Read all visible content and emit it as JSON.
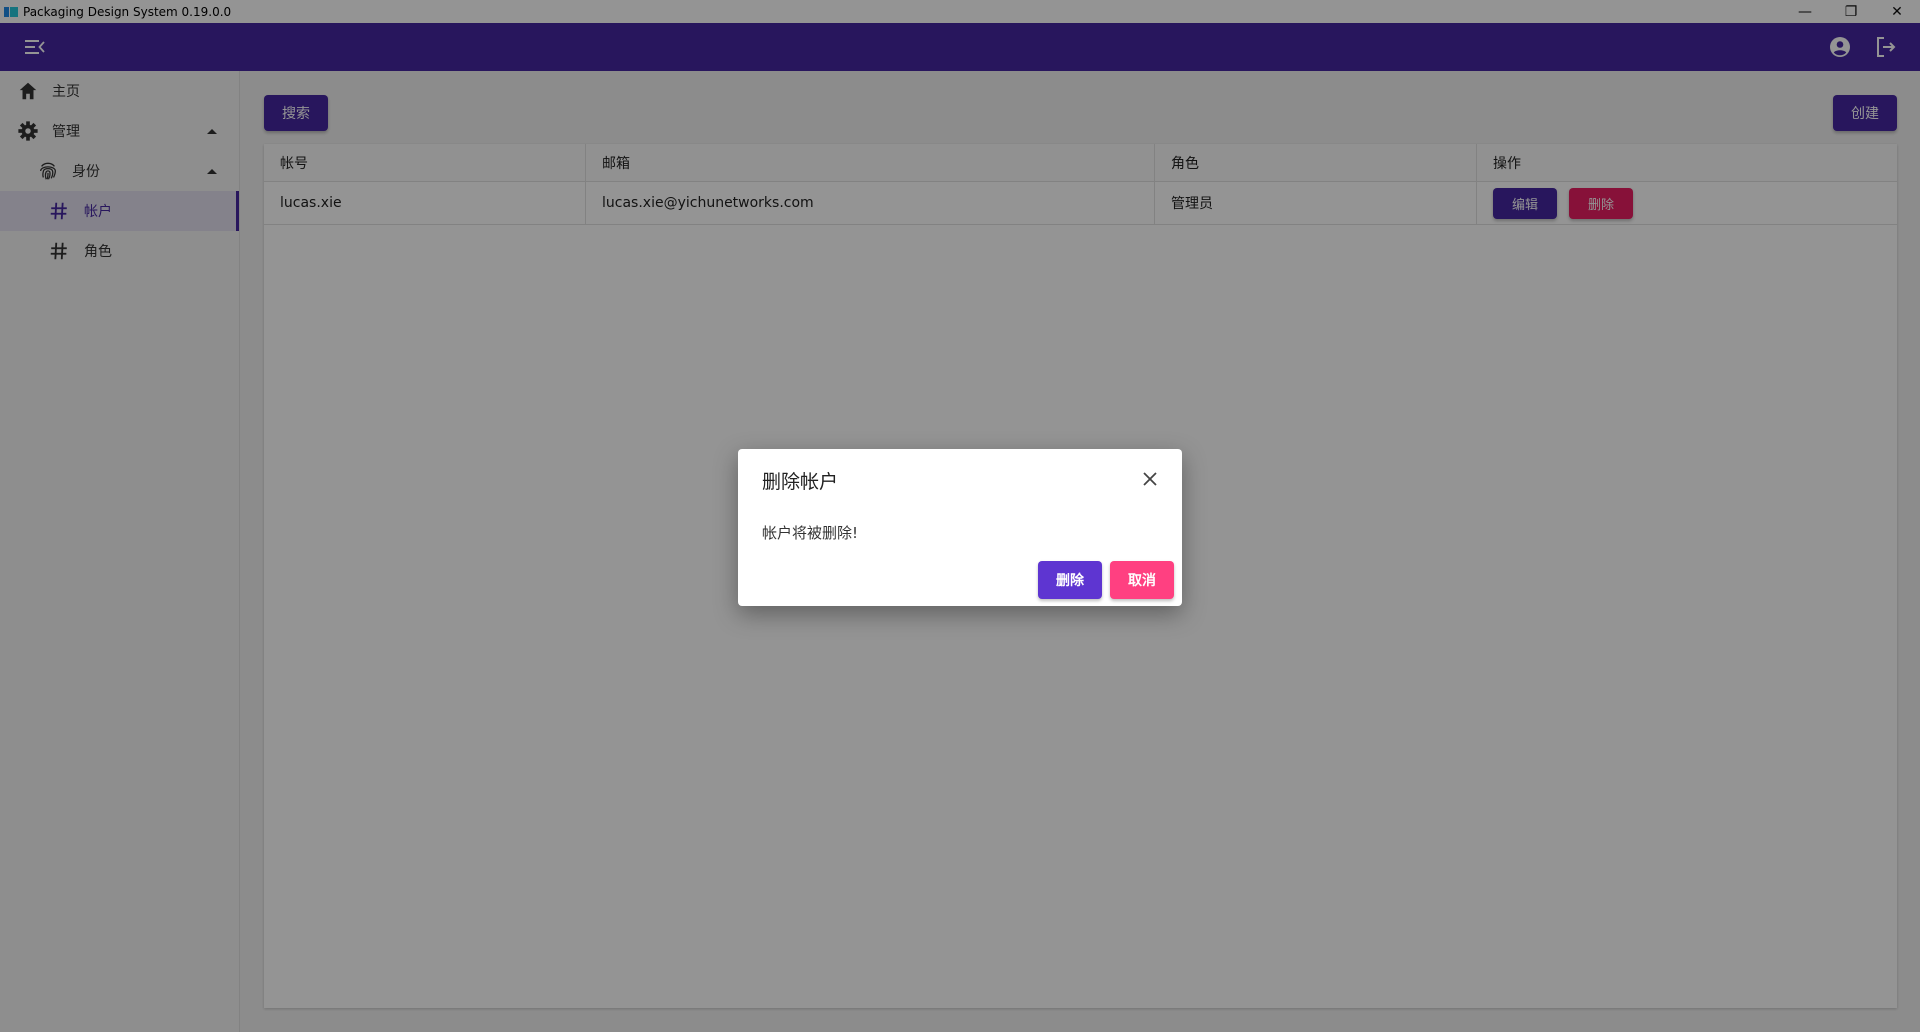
{
  "window": {
    "title": "Packaging Design System 0.19.0.0",
    "controls": {
      "minimize": "—",
      "restore": "❐",
      "close": "✕"
    }
  },
  "appbar": {
    "menu_icon": "menu-open-icon",
    "account_icon": "account-circle-icon",
    "logout_icon": "logout-icon"
  },
  "sidebar": {
    "items": [
      {
        "label": "主页",
        "icon": "home-icon"
      },
      {
        "label": "管理",
        "icon": "gear-icon"
      },
      {
        "label": "身份",
        "icon": "fingerprint-icon"
      },
      {
        "label": "帐户",
        "icon": "hash-icon",
        "active": true
      },
      {
        "label": "角色",
        "icon": "hash-icon"
      }
    ]
  },
  "toolbar": {
    "search_label": "搜索",
    "create_label": "创建"
  },
  "table": {
    "columns": [
      "帐号",
      "邮箱",
      "角色",
      "操作"
    ],
    "rows": [
      {
        "account": "lucas.xie",
        "email": "lucas.xie@yichunetworks.com",
        "role": "管理员",
        "edit_label": "编辑",
        "delete_label": "删除"
      }
    ]
  },
  "dialog": {
    "title": "删除帐户",
    "message": "帐户将被删除!",
    "confirm_label": "删除",
    "cancel_label": "取消"
  },
  "colors": {
    "primary": "#4527a0",
    "pink": "#e91e63",
    "dialog_confirm": "#5e35d1",
    "dialog_cancel": "#ff4081"
  }
}
